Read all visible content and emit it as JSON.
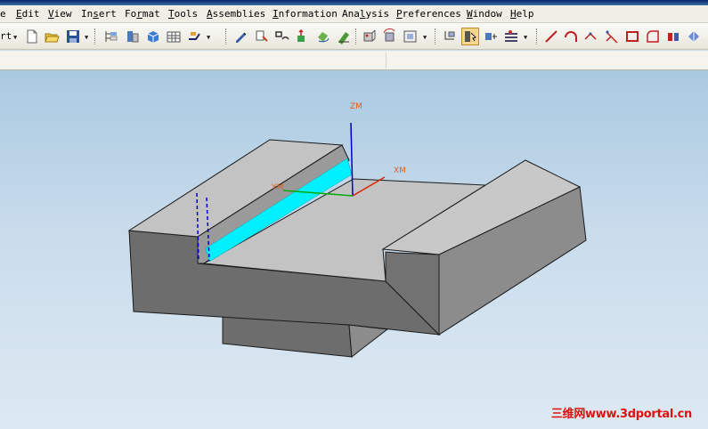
{
  "menubar": {
    "items": [
      {
        "label": "e",
        "accel": "",
        "name": "file"
      },
      {
        "label": "Edit",
        "accel": "E",
        "name": "edit"
      },
      {
        "label": "View",
        "accel": "V",
        "name": "view"
      },
      {
        "label": "Insert",
        "accel": "s",
        "name": "insert"
      },
      {
        "label": "Format",
        "accel": "r",
        "name": "format"
      },
      {
        "label": "Tools",
        "accel": "T",
        "name": "tools"
      },
      {
        "label": "Assemblies",
        "accel": "A",
        "name": "assemblies"
      },
      {
        "label": "Information",
        "accel": "I",
        "name": "information"
      },
      {
        "label": "Analysis",
        "accel": "l",
        "name": "analysis"
      },
      {
        "label": "Preferences",
        "accel": "P",
        "name": "preferences"
      },
      {
        "label": "Window",
        "accel": "W",
        "name": "window"
      },
      {
        "label": "Help",
        "accel": "H",
        "name": "help"
      }
    ]
  },
  "toolbar": {
    "start_label": "rt",
    "icons": [
      "new-icon",
      "open-icon",
      "save-icon",
      "part-navigator-icon",
      "assembly-icon",
      "block-icon",
      "table-icon",
      "features-icon",
      "edit-feature-icon",
      "feature-param-icon",
      "sketch-icon",
      "extrude-icon",
      "revolve-icon",
      "edit-sketch-icon",
      "view-orient-icon",
      "rotate-view-icon",
      "fit-view-icon",
      "wcs-icon",
      "selection-filter-icon",
      "snap-point-icon",
      "layer-icon",
      "line-icon",
      "arc-icon",
      "point-icon",
      "trim-icon",
      "rectangle-icon",
      "fillet-icon",
      "mirror-icon",
      "render-icon"
    ]
  },
  "viewport": {
    "axes": {
      "zm": "ZM",
      "xm": "XM",
      "ym": "YM"
    },
    "colors": {
      "top_face": "#c3c3c3",
      "front_face": "#6d6d6d",
      "side_face": "#8c8c8c",
      "groove": "#00f0ff",
      "edge": "#1a1a1a",
      "z_axis": "#0000cc",
      "x_axis": "#dd2200",
      "y_axis": "#00aa00"
    }
  },
  "watermark": {
    "text": "三维网www.3dportal.cn",
    "color": "#e01010"
  }
}
